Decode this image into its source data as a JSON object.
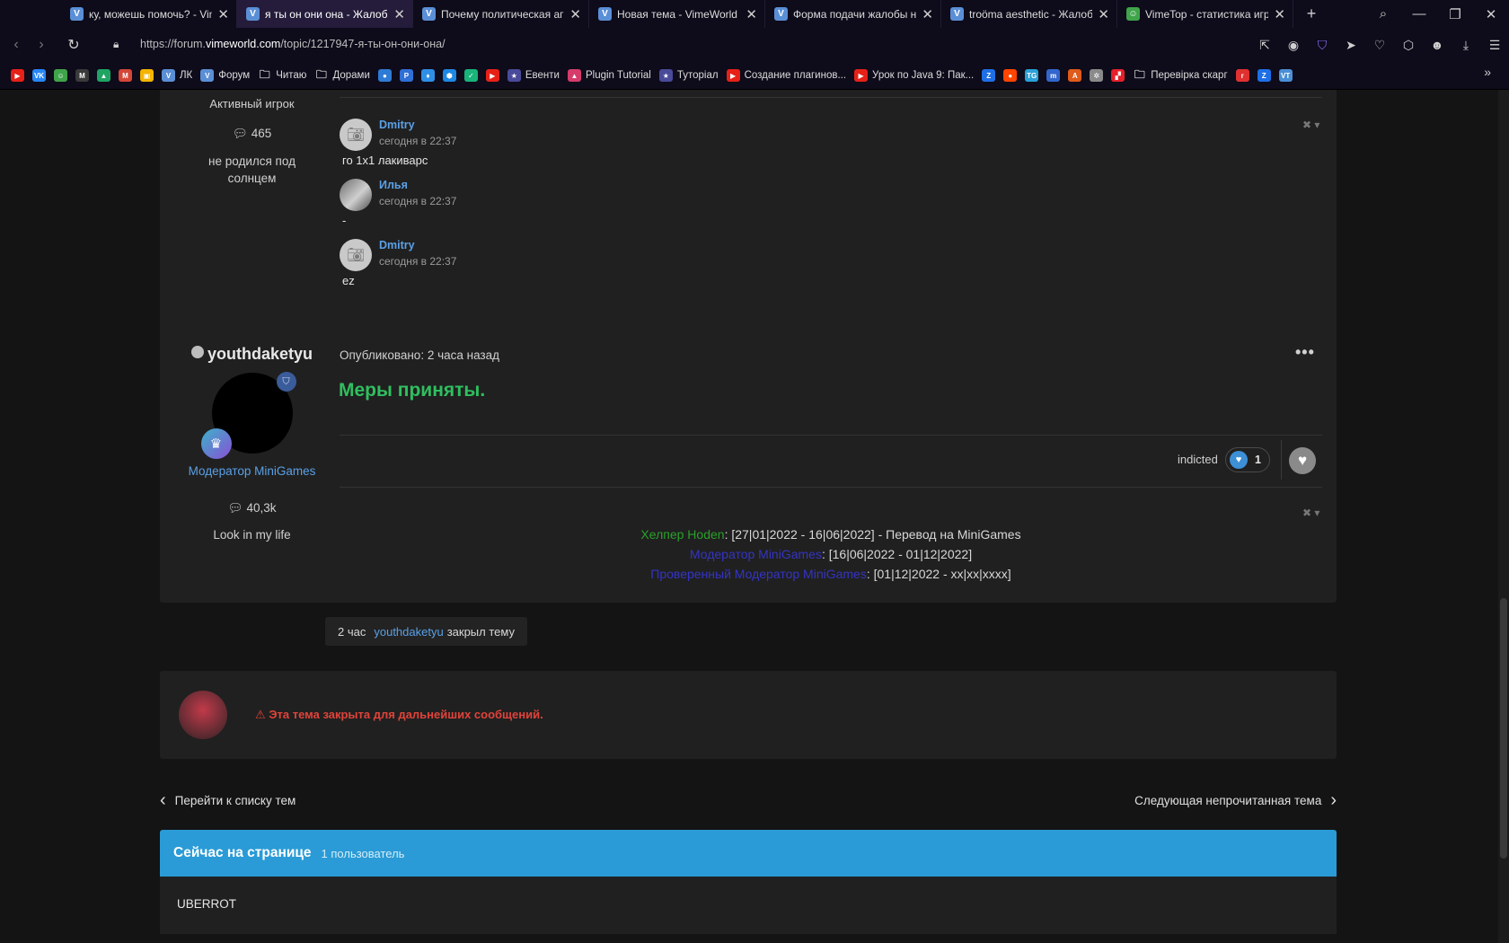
{
  "browser": {
    "tabs": [
      {
        "title": "ку, можешь помочь? - VimeWorld",
        "active": false
      },
      {
        "title": "я ты он они она - Жалобы на",
        "active": true
      },
      {
        "title": "Почему политическая агитация",
        "active": false
      },
      {
        "title": "Новая тема - VimeWorld - Форум",
        "active": false
      },
      {
        "title": "Форма подачи жалобы на правила",
        "active": false
      },
      {
        "title": "troöma aesthetic - Жалобы на",
        "active": false
      },
      {
        "title": "VimeTop - статистика игроков",
        "active": false
      }
    ],
    "url_prefix": "https://forum.",
    "url_domain": "vimeworld.com",
    "url_path": "/topic/1217947-я-ты-он-они-она/",
    "bookmarks": [
      {
        "label": "",
        "color": "#e62117",
        "glyph": "▶"
      },
      {
        "label": "",
        "color": "#2787f5",
        "glyph": "VK"
      },
      {
        "label": "",
        "color": "#3fa44a",
        "glyph": "☺"
      },
      {
        "label": "",
        "color": "#3a3a3a",
        "glyph": "M"
      },
      {
        "label": "",
        "color": "#1fa463",
        "glyph": "▲"
      },
      {
        "label": "",
        "color": "#d44638",
        "glyph": "M"
      },
      {
        "label": "",
        "color": "#f4b400",
        "glyph": "▣"
      },
      {
        "label": "ЛК",
        "color": "#5a8fd6",
        "glyph": "V"
      },
      {
        "label": "Форум",
        "color": "#5a8fd6",
        "glyph": "V"
      },
      {
        "label": "Читаю",
        "color": "",
        "glyph": "folder"
      },
      {
        "label": "Дорами",
        "color": "",
        "glyph": "folder"
      },
      {
        "label": "",
        "color": "#2e7bd6",
        "glyph": "●"
      },
      {
        "label": "",
        "color": "#2f6fd6",
        "glyph": "P"
      },
      {
        "label": "",
        "color": "#2f8fe6",
        "glyph": "♦"
      },
      {
        "label": "",
        "color": "#1e88e5",
        "glyph": "⬢"
      },
      {
        "label": "",
        "color": "#19b37b",
        "glyph": "✓"
      },
      {
        "label": "",
        "color": "#e62117",
        "glyph": "▶"
      },
      {
        "label": "Евенти",
        "color": "#4a4a9a",
        "glyph": "★"
      },
      {
        "label": "Plugin Tutorial",
        "color": "#d63b6b",
        "glyph": "▲"
      },
      {
        "label": "Туторіал",
        "color": "#4a4a9a",
        "glyph": "★"
      },
      {
        "label": "Создание плагинов...",
        "color": "#e62117",
        "glyph": "▶"
      },
      {
        "label": "Урок по Java 9: Пак...",
        "color": "#e62117",
        "glyph": "▶"
      },
      {
        "label": "",
        "color": "#1e6fe6",
        "glyph": "Z"
      },
      {
        "label": "",
        "color": "#ff4500",
        "glyph": "●"
      },
      {
        "label": "",
        "color": "#2aa1d6",
        "glyph": "TG"
      },
      {
        "label": "",
        "color": "#3366cc",
        "glyph": "m"
      },
      {
        "label": "",
        "color": "#e05a1a",
        "glyph": "A"
      },
      {
        "label": "",
        "color": "#8a8a8a",
        "glyph": "✲"
      },
      {
        "label": "",
        "color": "#e6202a",
        "glyph": "▞"
      },
      {
        "label": "Перевірка скарг",
        "color": "",
        "glyph": "folder"
      },
      {
        "label": "",
        "color": "#e03030",
        "glyph": "r"
      },
      {
        "label": "",
        "color": "#1e6fe6",
        "glyph": "Z"
      },
      {
        "label": "",
        "color": "#4a8fd6",
        "glyph": "VT"
      }
    ]
  },
  "top_card": {
    "author_rank": "Активный игрок",
    "author_posts": "465",
    "author_status": "не родился под солнцем",
    "comments": [
      {
        "name": "Dmitry",
        "date": "сегодня в 22:37",
        "text": "го 1х1 лакиварс",
        "avatar": "camera"
      },
      {
        "name": "Илья",
        "date": "сегодня в 22:37",
        "text": "-",
        "avatar": "photo"
      },
      {
        "name": "Dmitry",
        "date": "сегодня в 22:37",
        "text": "ez",
        "avatar": "camera"
      }
    ]
  },
  "post": {
    "author": "youthdaketyu",
    "published": "Опубликовано: 2 часа назад",
    "body": "Меры приняты.",
    "role": "Модератор MiniGames",
    "posts": "40,3k",
    "status": "Look in my life",
    "reaction_user": "indicted",
    "reaction_count": "1",
    "signature": [
      {
        "role": "Хелпер Hoden",
        "color": "#2aa02a",
        "text": ": [27|01|2022 - 16|06|2022] - Перевод на MiniGames"
      },
      {
        "role": "Модератор MiniGames",
        "color": "#3434c4",
        "text": ": [16|06|2022 - 01|12|2022]"
      },
      {
        "role": "Проверенный Модератор MiniGames",
        "color": "#3434c4",
        "text": ": [01|12|2022 - xx|xx|xxxx]"
      }
    ]
  },
  "event": {
    "time": "2 час",
    "user": "youthdaketyu",
    "action": "закрыл тему"
  },
  "locked_message": "Эта тема закрыта для дальнейших сообщений.",
  "nav": {
    "back": "Перейти к списку тем",
    "next": "Следующая непрочитанная тема"
  },
  "online": {
    "title": "Сейчас на странице",
    "count": "1 пользователь",
    "users": [
      "UBERROT"
    ]
  },
  "colors": {
    "accent_blue": "#2a9bd6",
    "success_green": "#2fbf5f",
    "locked_red": "#e0433a",
    "link_blue": "#5aa0e6"
  }
}
